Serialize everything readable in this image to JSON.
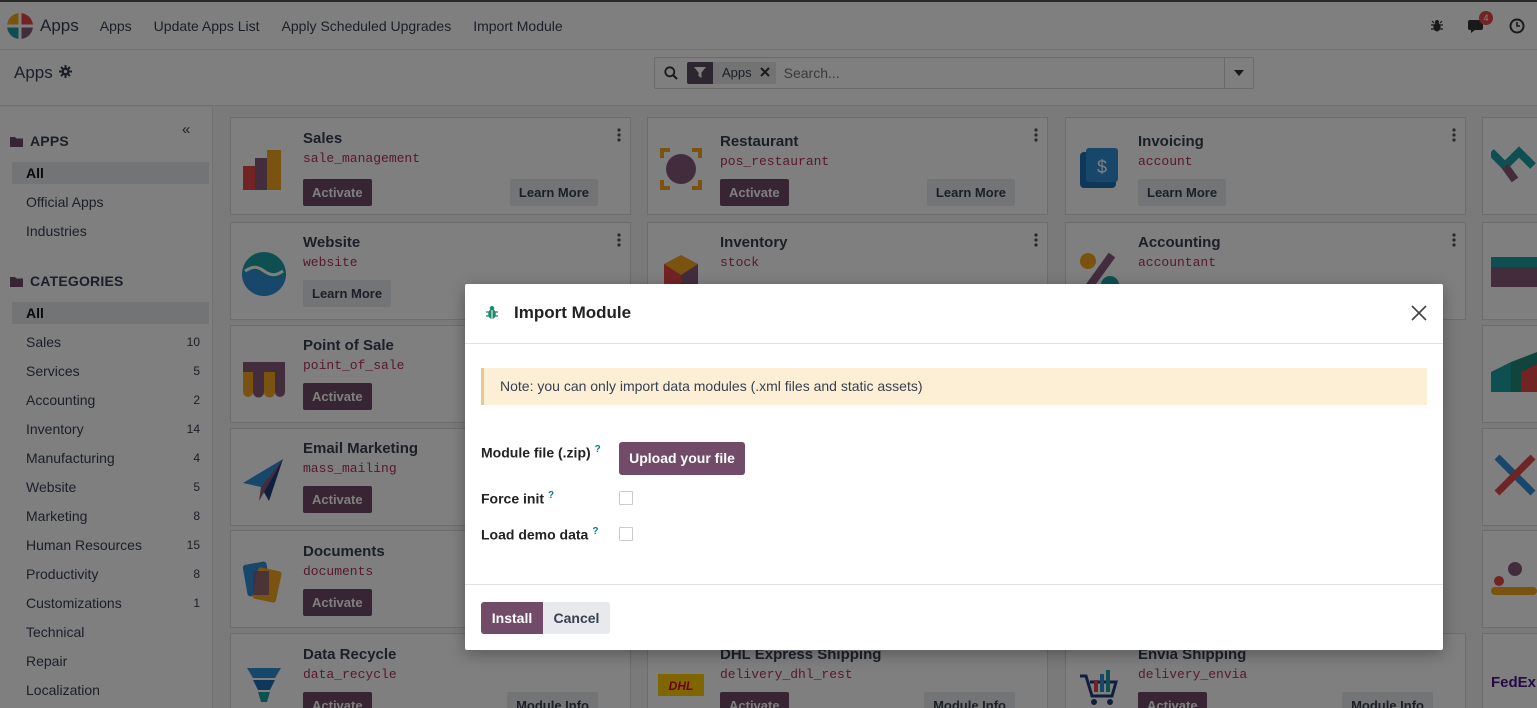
{
  "navbar": {
    "app_name": "Apps",
    "menu": [
      "Apps",
      "Update Apps List",
      "Apply Scheduled Upgrades",
      "Import Module"
    ],
    "messages_badge": "4",
    "icons": [
      "debug-bug-icon",
      "chat-icon",
      "clock-icon"
    ]
  },
  "control_panel": {
    "breadcrumb": "Apps",
    "facet_label": "Apps",
    "search_placeholder": "Search..."
  },
  "sidebar": {
    "apps_heading": "APPS",
    "apps_items": [
      "All",
      "Official Apps",
      "Industries"
    ],
    "categories_heading": "CATEGORIES",
    "categories": [
      {
        "label": "All",
        "count": ""
      },
      {
        "label": "Sales",
        "count": "10"
      },
      {
        "label": "Services",
        "count": "5"
      },
      {
        "label": "Accounting",
        "count": "2"
      },
      {
        "label": "Inventory",
        "count": "14"
      },
      {
        "label": "Manufacturing",
        "count": "4"
      },
      {
        "label": "Website",
        "count": "5"
      },
      {
        "label": "Marketing",
        "count": "8"
      },
      {
        "label": "Human Resources",
        "count": "15"
      },
      {
        "label": "Productivity",
        "count": "8"
      },
      {
        "label": "Customizations",
        "count": "1"
      },
      {
        "label": "Technical",
        "count": ""
      },
      {
        "label": "Repair",
        "count": ""
      },
      {
        "label": "Localization",
        "count": ""
      }
    ]
  },
  "cards": [
    {
      "title": "Sales",
      "tech": "sale_management",
      "primary": "Activate",
      "secondary": "Learn More"
    },
    {
      "title": "Restaurant",
      "tech": "pos_restaurant",
      "primary": "Activate",
      "secondary": "Learn More"
    },
    {
      "title": "Invoicing",
      "tech": "account",
      "primary": "",
      "secondary": "Learn More"
    },
    {
      "title": "Website",
      "tech": "website",
      "primary": "",
      "secondary": "Learn More"
    },
    {
      "title": "Inventory",
      "tech": "stock",
      "primary": "",
      "secondary": ""
    },
    {
      "title": "Accounting",
      "tech": "accountant",
      "primary": "",
      "secondary": ""
    },
    {
      "title": "Point of Sale",
      "tech": "point_of_sale",
      "primary": "Activate",
      "secondary": ""
    },
    {
      "title": "Email Marketing",
      "tech": "mass_mailing",
      "primary": "Activate",
      "secondary": ""
    },
    {
      "title": "Documents",
      "tech": "documents",
      "primary": "Activate",
      "secondary": ""
    },
    {
      "title": "Data Recycle",
      "tech": "data_recycle",
      "primary": "Activate",
      "secondary": "Module Info"
    },
    {
      "title": "DHL Express Shipping",
      "tech": "delivery_dhl_rest",
      "primary": "Activate",
      "secondary": "Module Info"
    },
    {
      "title": "Envia Shipping",
      "tech": "delivery_envia",
      "primary": "Activate",
      "secondary": "Module Info"
    }
  ],
  "partial_logo_text": "FedEx",
  "modal": {
    "title": "Import Module",
    "note": "Note: you can only import data modules (.xml files and static assets)",
    "module_file_label": "Module file (.zip)",
    "upload_label": "Upload your file",
    "force_init_label": "Force init",
    "demo_data_label": "Load demo data",
    "help_mark": "?",
    "install_label": "Install",
    "cancel_label": "Cancel"
  },
  "colors": {
    "primary": "#714b67",
    "tech_name": "#b0325a",
    "note_bg": "#fcefd6",
    "help": "#017e84"
  }
}
